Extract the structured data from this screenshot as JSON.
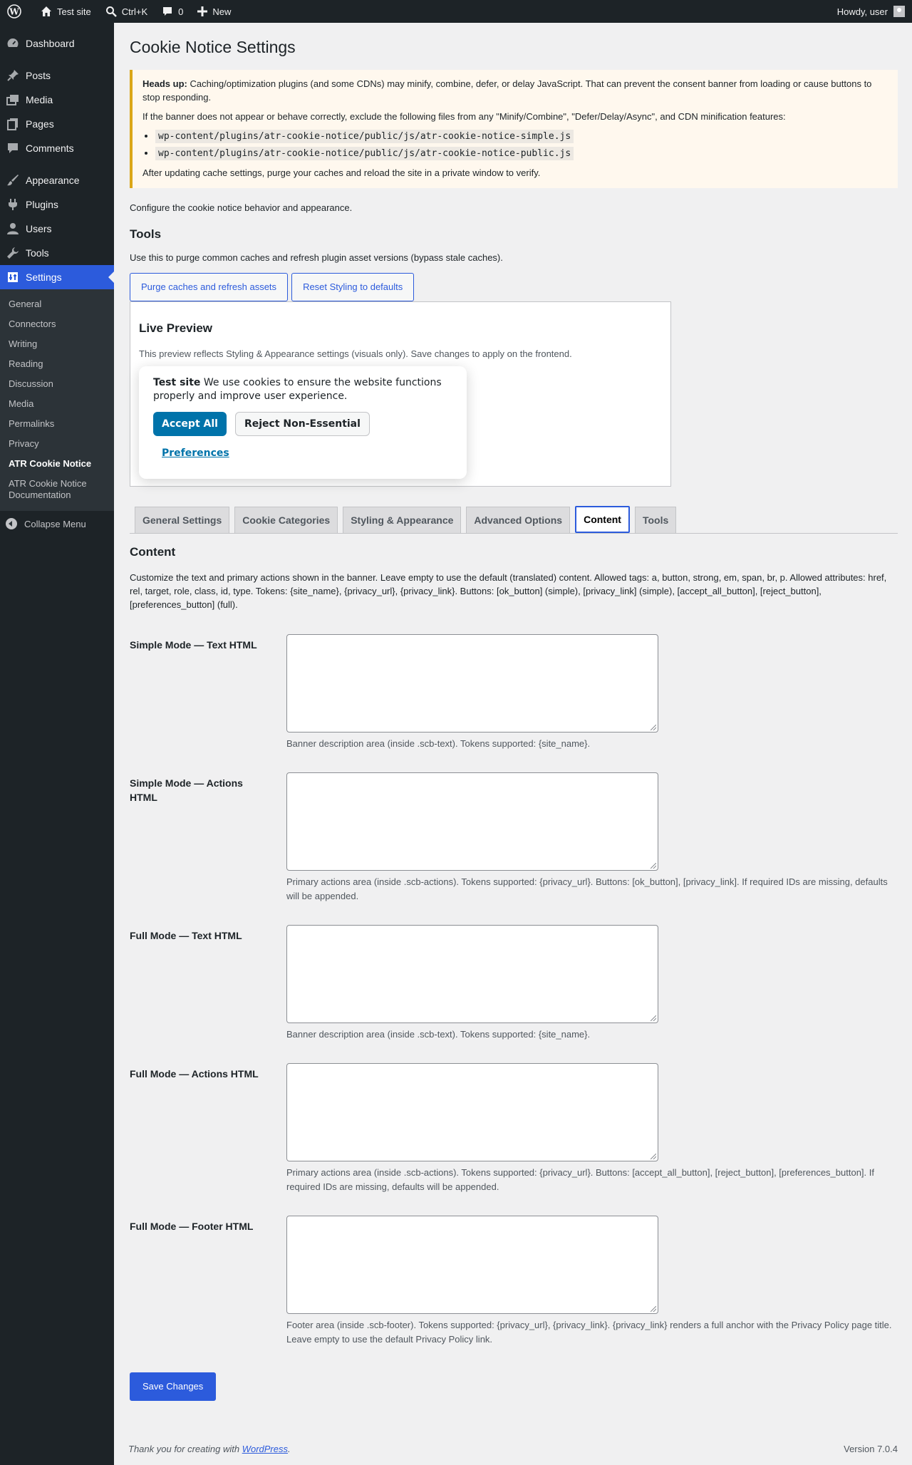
{
  "admin_bar": {
    "site_name": "Test site",
    "search_shortcut": "Ctrl+K",
    "comments_count": "0",
    "new_label": "New",
    "greeting": "Howdy, user"
  },
  "sidebar": {
    "items": [
      {
        "label": "Dashboard",
        "icon": "dashboard-icon"
      },
      {
        "label": "Posts",
        "icon": "pin-icon"
      },
      {
        "label": "Media",
        "icon": "media-icon"
      },
      {
        "label": "Pages",
        "icon": "pages-icon"
      },
      {
        "label": "Comments",
        "icon": "comment-icon"
      },
      {
        "label": "Appearance",
        "icon": "brush-icon"
      },
      {
        "label": "Plugins",
        "icon": "plug-icon"
      },
      {
        "label": "Users",
        "icon": "user-icon"
      },
      {
        "label": "Tools",
        "icon": "wrench-icon"
      },
      {
        "label": "Settings",
        "icon": "settings-icon"
      }
    ],
    "submenu": [
      "General",
      "Connectors",
      "Writing",
      "Reading",
      "Discussion",
      "Media",
      "Permalinks",
      "Privacy",
      "ATR Cookie Notice",
      "ATR Cookie Notice Documentation"
    ],
    "collapse_label": "Collapse Menu"
  },
  "page": {
    "title": "Cookie Notice Settings",
    "notice": {
      "heads_up_label": "Heads up:",
      "heads_up_text": " Caching/optimization plugins (and some CDNs) may minify, combine, defer, or delay JavaScript. That can prevent the consent banner from loading or cause buttons to stop responding.",
      "exclude_text": "If the banner does not appear or behave correctly, exclude the following files from any \"Minify/Combine\", \"Defer/Delay/Async\", and CDN minification features:",
      "files": [
        "wp-content/plugins/atr-cookie-notice/public/js/atr-cookie-notice-simple.js",
        "wp-content/plugins/atr-cookie-notice/public/js/atr-cookie-notice-public.js"
      ],
      "after_text": "After updating cache settings, purge your caches and reload the site in a private window to verify."
    },
    "configure_text": "Configure the cookie notice behavior and appearance.",
    "tools_heading": "Tools",
    "tools_desc": "Use this to purge common caches and refresh plugin asset versions (bypass stale caches).",
    "purge_button": "Purge caches and refresh assets",
    "reset_button": "Reset Styling to defaults",
    "preview": {
      "heading": "Live Preview",
      "desc": "This preview reflects Styling & Appearance settings (visuals only). Save changes to apply on the frontend.",
      "banner_site": "Test site",
      "banner_text": " We use cookies to ensure the website functions properly and improve user experience.",
      "accept_label": "Accept All",
      "reject_label": "Reject Non-Essential",
      "preferences_label": "Preferences"
    },
    "tabs": [
      "General Settings",
      "Cookie Categories",
      "Styling & Appearance",
      "Advanced Options",
      "Content",
      "Tools"
    ],
    "active_tab": "Content",
    "content_heading": "Content",
    "content_desc": "Customize the text and primary actions shown in the banner. Leave empty to use the default (translated) content. Allowed tags: a, button, strong, em, span, br, p. Allowed attributes: href, rel, target, role, class, id, type. Tokens: {site_name}, {privacy_url}, {privacy_link}. Buttons: [ok_button] (simple), [privacy_link] (simple), [accept_all_button], [reject_button], [preferences_button] (full).",
    "fields": [
      {
        "label": "Simple Mode — Text HTML",
        "hint": "Banner description area (inside .scb-text). Tokens supported: {site_name}."
      },
      {
        "label": "Simple Mode — Actions HTML",
        "hint": "Primary actions area (inside .scb-actions). Tokens supported: {privacy_url}. Buttons: [ok_button], [privacy_link]. If required IDs are missing, defaults will be appended."
      },
      {
        "label": "Full Mode — Text HTML",
        "hint": "Banner description area (inside .scb-text). Tokens supported: {site_name}."
      },
      {
        "label": "Full Mode — Actions HTML",
        "hint": "Primary actions area (inside .scb-actions). Tokens supported: {privacy_url}. Buttons: [accept_all_button], [reject_button], [preferences_button]. If required IDs are missing, defaults will be appended."
      },
      {
        "label": "Full Mode — Footer HTML",
        "hint": "Footer area (inside .scb-footer). Tokens supported: {privacy_url}, {privacy_link}. {privacy_link} renders a full anchor with the Privacy Policy page title. Leave empty to use the default Privacy Policy link."
      }
    ],
    "save_button": "Save Changes"
  },
  "footer": {
    "thanks_prefix": "Thank you for creating with ",
    "wp_link": "WordPress",
    "thanks_suffix": ".",
    "version": "Version 7.0.4"
  },
  "colors": {
    "accent": "#2c5bdc",
    "admin_bg": "#1d2327",
    "notice_border": "#dba617",
    "banner_button": "#0073aa"
  }
}
